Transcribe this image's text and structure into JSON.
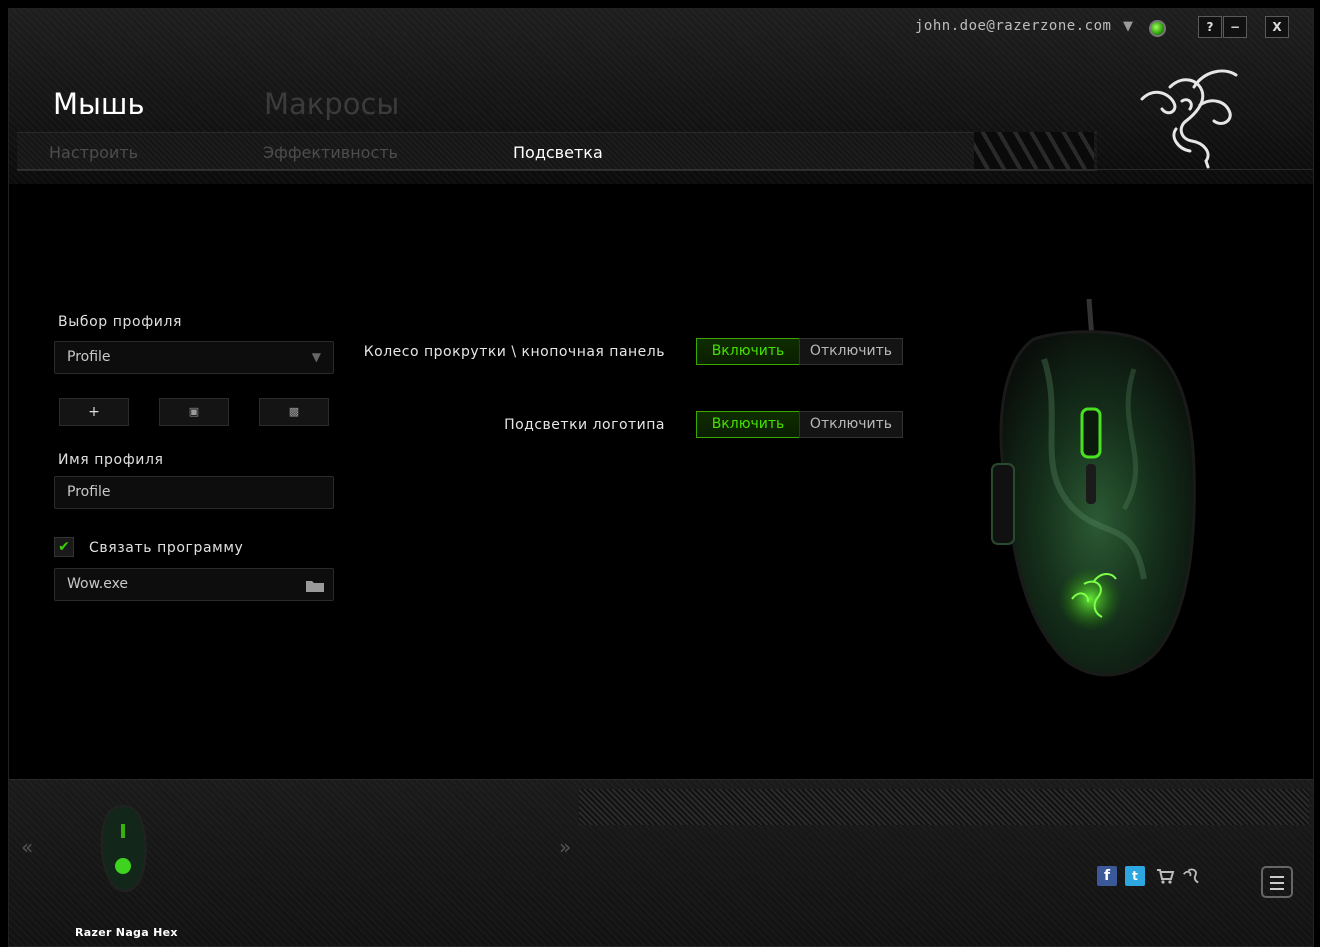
{
  "account": {
    "email": "john.doe@razerzone.com"
  },
  "window_buttons": {
    "help": "?",
    "minimize": "−",
    "close": "X"
  },
  "nav": {
    "main_tabs": [
      "Мышь",
      "Макросы"
    ],
    "sub_tabs": [
      "Настроить",
      "Эффективность",
      "Подсветка"
    ],
    "active_main": "Мышь",
    "active_sub": "Подсветка"
  },
  "profile": {
    "select_label": "Выбор профиля",
    "selected": "Profile",
    "add_label": "+",
    "name_label": "Имя профиля",
    "name_value": "Profile",
    "link_label": "Связать программу",
    "link_checked": true,
    "program": "Wow.exe"
  },
  "lighting": [
    {
      "label": "Колесо прокрутки \\ кнопочная панель",
      "on_label": "Включить",
      "off_label": "Отключить",
      "state": "on"
    },
    {
      "label": "Подсветки логотипа",
      "on_label": "Включить",
      "off_label": "Отключить",
      "state": "on"
    }
  ],
  "footer": {
    "device_name": "Razer Naga Hex",
    "prev": "«",
    "next": "»"
  },
  "colors": {
    "accent": "#44d62c",
    "bg": "#000000"
  }
}
